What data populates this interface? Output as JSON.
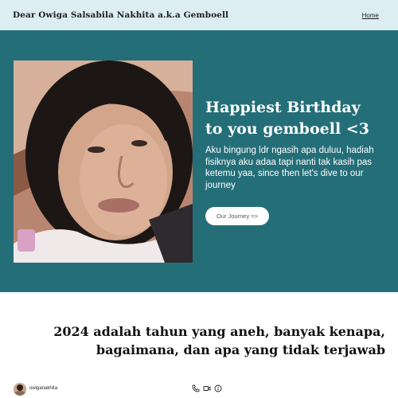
{
  "header": {
    "site_title": "Dear Owiga Salsabila Nakhita a.k.a Gemboell",
    "nav_home": "Home"
  },
  "hero": {
    "heading_line1": "Happiest Birthday",
    "heading_line2": "to you gemboell <3",
    "body": "Aku bingung ldr ngasih apa duluu, hadiah fisiknya aku adaa tapi nanti tak kasih pas ketemu yaa, since then let's dive to our journey",
    "button_label": "Our Journey =>",
    "photo_icon": "portrait-photo"
  },
  "section": {
    "heading_line1": "2024 adalah tahun yang aneh, banyak kenapa,",
    "heading_line2": "bagaimana, dan apa yang tidak terjawab"
  },
  "footer": {
    "username": "owiganakhita",
    "icons": [
      "phone-icon",
      "video-icon",
      "info-icon"
    ]
  },
  "colors": {
    "topbar_bg": "#ddeef2",
    "hero_bg": "#246e78",
    "button_bg": "#ffffff"
  }
}
